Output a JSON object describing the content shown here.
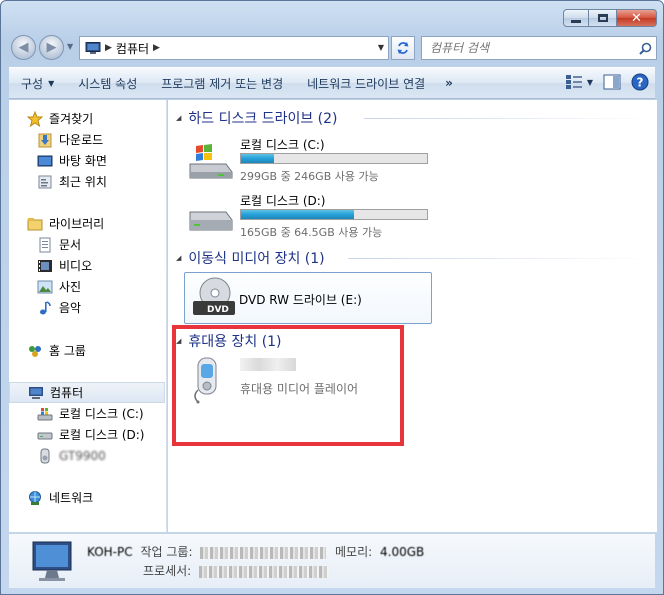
{
  "address": {
    "breadcrumb": "컴퓨터",
    "search_placeholder": "컴퓨터 검색"
  },
  "commands": {
    "organize": "구성",
    "system_properties": "시스템 속성",
    "uninstall": "프로그램 제거 또는 변경",
    "map_network_drive": "네트워크 드라이브 연결",
    "more": "»"
  },
  "nav": {
    "favorites": {
      "label": "즐겨찾기",
      "items": [
        "다운로드",
        "바탕 화면",
        "최근 위치"
      ]
    },
    "libraries": {
      "label": "라이브러리",
      "items": [
        "문서",
        "비디오",
        "사진",
        "음악"
      ]
    },
    "homegroup": "홈 그룹",
    "computer": {
      "label": "컴퓨터",
      "items": [
        "로컬 디스크 (C:)",
        "로컬 디스크 (D:)",
        "GT9900"
      ]
    },
    "network": "네트워크"
  },
  "groups": {
    "hard_disks": "하드 디스크 드라이브 (2)",
    "removable": "이동식 미디어 장치 (1)",
    "portable": "휴대용 장치 (1)"
  },
  "drives": [
    {
      "name": "로컬 디스크 (C:)",
      "free": "299GB 중 246GB 사용 가능",
      "used_fraction": 0.18
    },
    {
      "name": "로컬 디스크 (D:)",
      "free": "165GB 중 64.5GB 사용 가능",
      "used_fraction": 0.61
    }
  ],
  "dvd": {
    "name": "DVD RW 드라이브 (E:)",
    "icon_label": "DVD"
  },
  "portable_device": {
    "subtitle": "휴대용 미디어 플레이어"
  },
  "details": {
    "computer_name": "KOH-PC",
    "workgroup_label": "작업 그룹:",
    "memory_label": "메모리:",
    "memory_value": "4.00GB",
    "processor_label": "프로세서:"
  },
  "colors": {
    "highlight": "#e8343b",
    "group_header": "#1e3287",
    "drive_fill": "#26a0da"
  }
}
